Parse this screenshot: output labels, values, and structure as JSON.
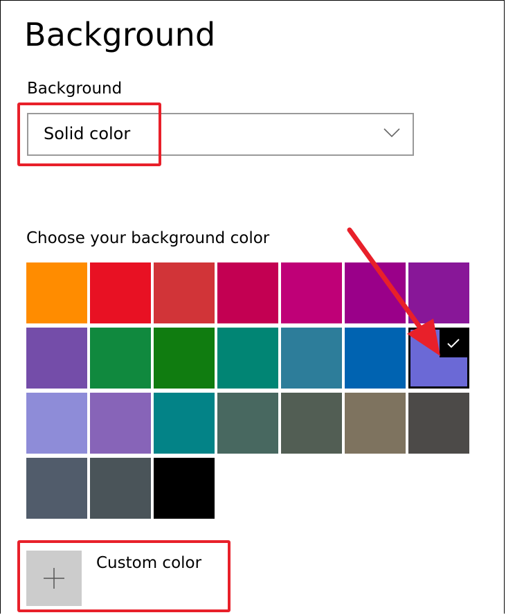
{
  "page": {
    "title": "Background"
  },
  "background_setting": {
    "label": "Background",
    "selected_value": "Solid color",
    "chevron_icon": "chevron-down-icon"
  },
  "color_picker": {
    "label": "Choose your background color",
    "selected_color": "#6b69d6",
    "check_icon": "checkmark-icon",
    "swatches": [
      "#ff8c00",
      "#e81123",
      "#d13438",
      "#c30052",
      "#bf0077",
      "#9a0089",
      "#881798",
      "#744da9",
      "#10893e",
      "#107c10",
      "#018574",
      "#2d7d9a",
      "#0063b1",
      "#6b69d6",
      "#8e8cd8",
      "#8764b8",
      "#038387",
      "#486860",
      "#525e54",
      "#7e735f",
      "#4c4a48",
      "#515c6b",
      "#4a5459",
      "#000000"
    ]
  },
  "custom_color": {
    "label": "Custom color",
    "icon": "plus-icon"
  },
  "annotations": {
    "color": "#e8202a"
  }
}
